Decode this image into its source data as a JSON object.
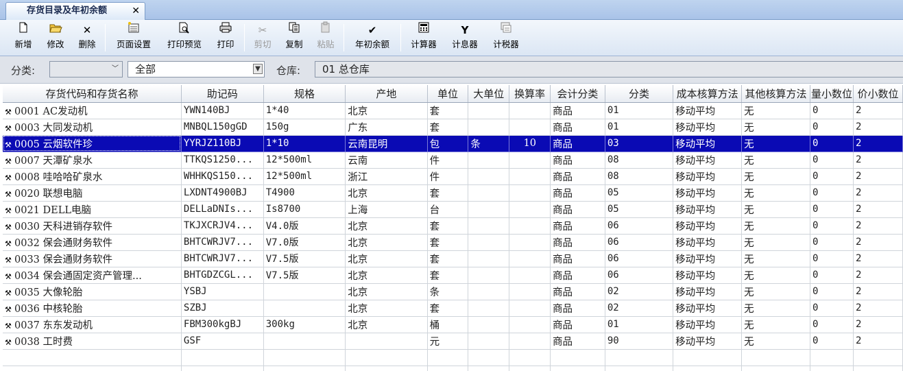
{
  "tab": {
    "title": "存货目录及年初余额",
    "close": "✕"
  },
  "toolbar": {
    "new": "新增",
    "edit": "修改",
    "delete": "删除",
    "page_setup": "页面设置",
    "print_preview": "打印预览",
    "print": "打印",
    "cut": "剪切",
    "copy": "复制",
    "paste": "粘贴",
    "opening_balance": "年初余额",
    "calculator": "计算器",
    "interest_calc": "计息器",
    "tax_calc": "计税器"
  },
  "filter": {
    "category_label": "分类:",
    "category_value": "",
    "scope_value": "全部",
    "warehouse_label": "仓库:",
    "warehouse_value": "01 总仓库"
  },
  "columns": [
    "存货代码和存货名称",
    "助记码",
    "规格",
    "产地",
    "单位",
    "大单位",
    "换算率",
    "会计分类",
    "分类",
    "成本核算方法",
    "其他核算方法",
    "量小数位",
    "价小数位"
  ],
  "rows": [
    {
      "code": "0001",
      "name": "AC发动机",
      "mnemonic": "YWN140BJ",
      "spec": "1*40",
      "origin": "北京",
      "unit": "套",
      "big_unit": "",
      "ratio": "",
      "acct": "商品",
      "cat": "01",
      "cost": "移动平均",
      "other": "无",
      "qty_dec": "0",
      "price_dec": "2"
    },
    {
      "code": "0003",
      "name": "大同发动机",
      "mnemonic": "MNBQL150gGD",
      "spec": "150g",
      "origin": "广东",
      "unit": "套",
      "big_unit": "",
      "ratio": "",
      "acct": "商品",
      "cat": "01",
      "cost": "移动平均",
      "other": "无",
      "qty_dec": "0",
      "price_dec": "2"
    },
    {
      "code": "0005",
      "name": "云烟软件珍",
      "mnemonic": "YYRJZ110BJ",
      "spec": "1*10",
      "origin": "云南昆明",
      "unit": "包",
      "big_unit": "条",
      "ratio": "10",
      "acct": "商品",
      "cat": "03",
      "cost": "移动平均",
      "other": "无",
      "qty_dec": "0",
      "price_dec": "2"
    },
    {
      "code": "0007",
      "name": "天潭矿泉水",
      "mnemonic": "TTKQS1250...",
      "spec": "12*500ml",
      "origin": "云南",
      "unit": "件",
      "big_unit": "",
      "ratio": "",
      "acct": "商品",
      "cat": "08",
      "cost": "移动平均",
      "other": "无",
      "qty_dec": "0",
      "price_dec": "2"
    },
    {
      "code": "0008",
      "name": "哇哈哈矿泉水",
      "mnemonic": "WHHKQS150...",
      "spec": "12*500ml",
      "origin": "浙江",
      "unit": "件",
      "big_unit": "",
      "ratio": "",
      "acct": "商品",
      "cat": "08",
      "cost": "移动平均",
      "other": "无",
      "qty_dec": "0",
      "price_dec": "2"
    },
    {
      "code": "0020",
      "name": "联想电脑",
      "mnemonic": "LXDNT4900BJ",
      "spec": "T4900",
      "origin": "北京",
      "unit": "套",
      "big_unit": "",
      "ratio": "",
      "acct": "商品",
      "cat": "05",
      "cost": "移动平均",
      "other": "无",
      "qty_dec": "0",
      "price_dec": "2"
    },
    {
      "code": "0021",
      "name": "DELL电脑",
      "mnemonic": "DELLaDNIs...",
      "spec": "Is8700",
      "origin": "上海",
      "unit": "台",
      "big_unit": "",
      "ratio": "",
      "acct": "商品",
      "cat": "05",
      "cost": "移动平均",
      "other": "无",
      "qty_dec": "0",
      "price_dec": "2"
    },
    {
      "code": "0030",
      "name": "天科进销存软件",
      "mnemonic": "TKJXCRJV4...",
      "spec": "V4.0版",
      "origin": "北京",
      "unit": "套",
      "big_unit": "",
      "ratio": "",
      "acct": "商品",
      "cat": "06",
      "cost": "移动平均",
      "other": "无",
      "qty_dec": "0",
      "price_dec": "2"
    },
    {
      "code": "0032",
      "name": "保会通财务软件",
      "mnemonic": "BHTCWRJV7...",
      "spec": "V7.0版",
      "origin": "北京",
      "unit": "套",
      "big_unit": "",
      "ratio": "",
      "acct": "商品",
      "cat": "06",
      "cost": "移动平均",
      "other": "无",
      "qty_dec": "0",
      "price_dec": "2"
    },
    {
      "code": "0033",
      "name": "保会通财务软件",
      "mnemonic": "BHTCWRJV7...",
      "spec": "V7.5版",
      "origin": "北京",
      "unit": "套",
      "big_unit": "",
      "ratio": "",
      "acct": "商品",
      "cat": "06",
      "cost": "移动平均",
      "other": "无",
      "qty_dec": "0",
      "price_dec": "2"
    },
    {
      "code": "0034",
      "name": "保会通固定资产管理...",
      "mnemonic": "BHTGDZCGL...",
      "spec": "V7.5版",
      "origin": "北京",
      "unit": "套",
      "big_unit": "",
      "ratio": "",
      "acct": "商品",
      "cat": "06",
      "cost": "移动平均",
      "other": "无",
      "qty_dec": "0",
      "price_dec": "2"
    },
    {
      "code": "0035",
      "name": "大像轮胎",
      "mnemonic": "YSBJ",
      "spec": "",
      "origin": "北京",
      "unit": "条",
      "big_unit": "",
      "ratio": "",
      "acct": "商品",
      "cat": "02",
      "cost": "移动平均",
      "other": "无",
      "qty_dec": "0",
      "price_dec": "2"
    },
    {
      "code": "0036",
      "name": "中核轮胎",
      "mnemonic": "SZBJ",
      "spec": "",
      "origin": "北京",
      "unit": "套",
      "big_unit": "",
      "ratio": "",
      "acct": "商品",
      "cat": "02",
      "cost": "移动平均",
      "other": "无",
      "qty_dec": "0",
      "price_dec": "2"
    },
    {
      "code": "0037",
      "name": "东东发动机",
      "mnemonic": "FBM300kgBJ",
      "spec": "300kg",
      "origin": "北京",
      "unit": "桶",
      "big_unit": "",
      "ratio": "",
      "acct": "商品",
      "cat": "01",
      "cost": "移动平均",
      "other": "无",
      "qty_dec": "0",
      "price_dec": "2"
    },
    {
      "code": "0038",
      "name": "工时费",
      "mnemonic": "GSF",
      "spec": "",
      "origin": "",
      "unit": "元",
      "big_unit": "",
      "ratio": "",
      "acct": "商品",
      "cat": "90",
      "cost": "移动平均",
      "other": "无",
      "qty_dec": "0",
      "price_dec": "2"
    }
  ],
  "selected_row": 2,
  "row_icon": "key-icon"
}
